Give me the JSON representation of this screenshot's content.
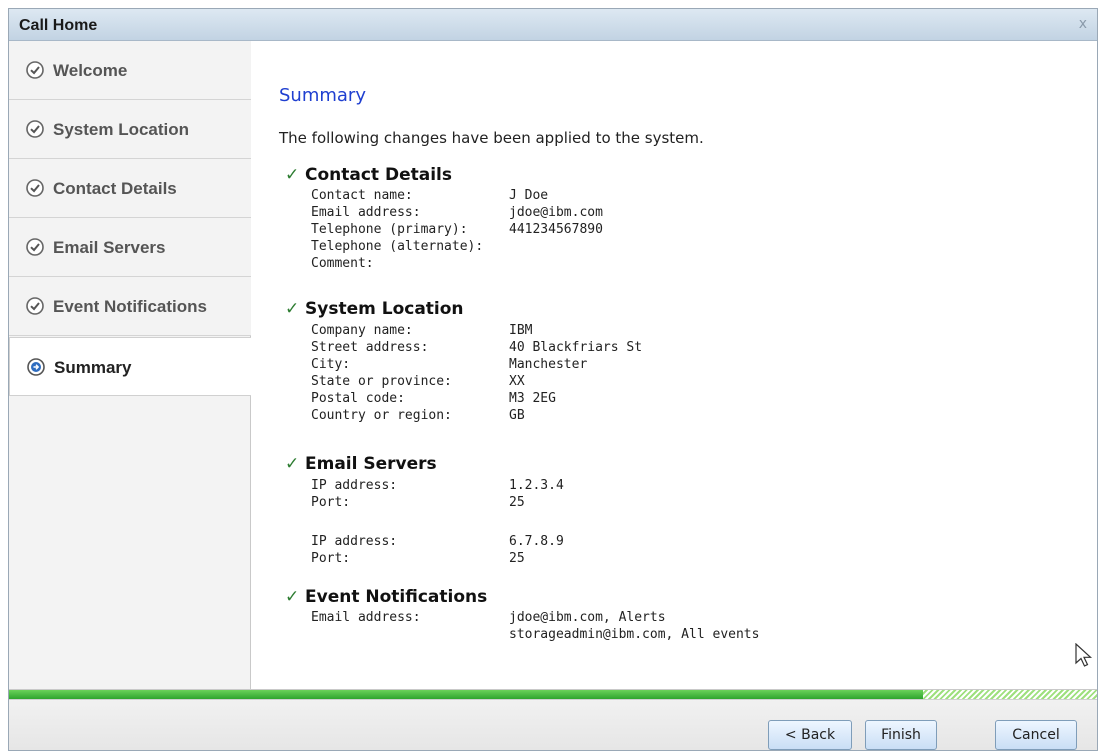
{
  "window": {
    "title": "Call Home",
    "close_label": "x"
  },
  "sidebar": {
    "items": [
      {
        "label": "Welcome",
        "icon": "check-circle-icon",
        "state": "completed"
      },
      {
        "label": "System Location",
        "icon": "check-circle-icon",
        "state": "completed"
      },
      {
        "label": "Contact Details",
        "icon": "check-circle-icon",
        "state": "completed"
      },
      {
        "label": "Email Servers",
        "icon": "check-circle-icon",
        "state": "completed"
      },
      {
        "label": "Event Notifications",
        "icon": "check-circle-icon",
        "state": "completed"
      },
      {
        "label": "Summary",
        "icon": "arrow-circle-icon",
        "state": "current"
      }
    ]
  },
  "main": {
    "title": "Summary",
    "intro": "The following changes have been applied to the system.",
    "sections": {
      "contact": {
        "heading": "Contact Details",
        "rows": [
          {
            "label": "Contact name:",
            "value": "J Doe"
          },
          {
            "label": "Email address:",
            "value": "jdoe@ibm.com"
          },
          {
            "label": "Telephone (primary):",
            "value": "441234567890"
          },
          {
            "label": "Telephone (alternate):",
            "value": ""
          },
          {
            "label": "Comment:",
            "value": ""
          }
        ]
      },
      "location": {
        "heading": "System Location",
        "rows": [
          {
            "label": "Company name:",
            "value": "IBM"
          },
          {
            "label": "Street address:",
            "value": "40 Blackfriars St"
          },
          {
            "label": "City:",
            "value": "Manchester"
          },
          {
            "label": "State or province:",
            "value": "XX"
          },
          {
            "label": "Postal code:",
            "value": "M3 2EG"
          },
          {
            "label": "Country or region:",
            "value": "GB"
          }
        ]
      },
      "email_servers": {
        "heading": "Email Servers",
        "rows": [
          {
            "label": "IP address:",
            "value": "1.2.3.4"
          },
          {
            "label": "Port:",
            "value": "25"
          },
          {
            "label": "IP address:",
            "value": "6.7.8.9"
          },
          {
            "label": "Port:",
            "value": "25"
          }
        ]
      },
      "notifications": {
        "heading": "Event Notifications",
        "rows": [
          {
            "label": "Email address:",
            "value": "jdoe@ibm.com, Alerts"
          },
          {
            "label": "",
            "value": "storageadmin@ibm.com, All events"
          }
        ]
      }
    }
  },
  "footer": {
    "progress_fraction": 0.84,
    "buttons": {
      "back": "< Back",
      "finish": "Finish",
      "cancel": "Cancel"
    }
  },
  "colors": {
    "accent_title": "#1f3fd0",
    "check": "#2e7d32",
    "progress": "#2fa52e"
  }
}
